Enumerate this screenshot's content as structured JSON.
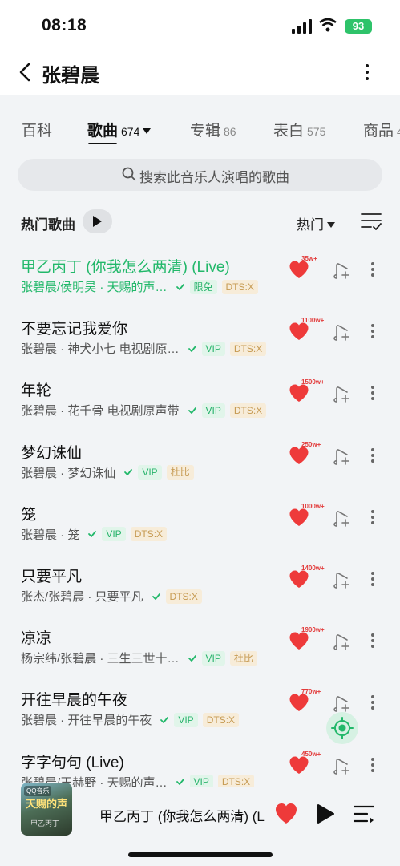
{
  "status_bar": {
    "time": "08:18",
    "battery": "93"
  },
  "header": {
    "title": "张碧晨"
  },
  "tabs": [
    {
      "label": "百科",
      "count": ""
    },
    {
      "label": "歌曲",
      "count": "674"
    },
    {
      "label": "专辑",
      "count": "86"
    },
    {
      "label": "表白",
      "count": "575"
    },
    {
      "label": "商品",
      "count": "4"
    }
  ],
  "search": {
    "placeholder": "搜索此音乐人演唱的歌曲"
  },
  "section": {
    "title": "热门歌曲",
    "sort_label": "热门"
  },
  "songs": [
    {
      "title": "甲乙丙丁 (你我怎么两清) (Live)",
      "meta": "张碧晨/侯明昊 · 天赐的声…",
      "tags": [
        "限免",
        "DTS:X"
      ],
      "likes": "35w+",
      "playing": true
    },
    {
      "title": "不要忘记我爱你",
      "meta": "张碧晨 · 神犬小七 电视剧原…",
      "tags": [
        "VIP",
        "DTS:X"
      ],
      "likes": "1100w+"
    },
    {
      "title": "年轮",
      "meta": "张碧晨 · 花千骨 电视剧原声带",
      "tags": [
        "VIP",
        "DTS:X"
      ],
      "likes": "1500w+"
    },
    {
      "title": "梦幻诛仙",
      "meta": "张碧晨 · 梦幻诛仙",
      "tags": [
        "VIP",
        "杜比"
      ],
      "likes": "250w+"
    },
    {
      "title": "笼",
      "meta": "张碧晨 · 笼",
      "tags": [
        "VIP",
        "DTS:X"
      ],
      "likes": "1000w+"
    },
    {
      "title": "只要平凡",
      "meta": "张杰/张碧晨 · 只要平凡",
      "tags": [
        "DTS:X"
      ],
      "likes": "1400w+"
    },
    {
      "title": "凉凉",
      "meta": "杨宗纬/张碧晨 · 三生三世十…",
      "tags": [
        "VIP",
        "杜比"
      ],
      "likes": "1900w+"
    },
    {
      "title": "开往早晨的午夜",
      "meta": "张碧晨 · 开往早晨的午夜",
      "tags": [
        "VIP",
        "DTS:X"
      ],
      "likes": "770w+"
    },
    {
      "title": "字字句句 (Live)",
      "meta": "张碧晨/王赫野 · 天赐的声…",
      "tags": [
        "VIP",
        "DTS:X"
      ],
      "likes": "450w+"
    }
  ],
  "player": {
    "title": "甲乙丙丁 (你我怎么两清) (Live)",
    "cover_badge": "QQ音乐",
    "cover_art": "天赐的声",
    "cover_caption": "甲乙丙丁"
  },
  "colors": {
    "accent": "#22b86a",
    "heart": "#ee3a3a",
    "tag_green_bg": "#e1f5ea",
    "tag_gold_bg": "#f7ecd9"
  }
}
